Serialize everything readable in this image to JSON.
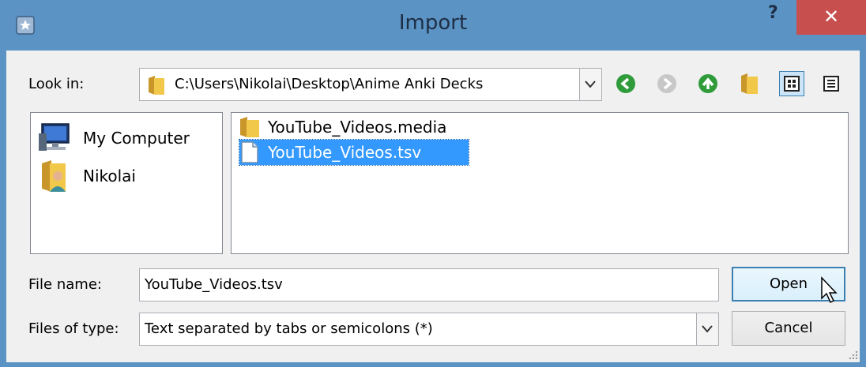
{
  "window": {
    "title": "Import",
    "help_label": "?",
    "close_label": "✕"
  },
  "toolbar": {
    "look_in_label": "Look in:",
    "path": "C:\\Users\\Nikolai\\Desktop\\Anime Anki Decks",
    "buttons": [
      "back-icon",
      "forward-icon",
      "up-icon",
      "new-folder-icon",
      "list-view-icon",
      "detail-view-icon"
    ]
  },
  "sidebar": {
    "items": [
      {
        "label": "My Computer",
        "icon": "computer-icon"
      },
      {
        "label": "Nikolai",
        "icon": "user-folder-icon"
      }
    ]
  },
  "files": {
    "items": [
      {
        "name": "YouTube_Videos.media",
        "icon": "folder-icon",
        "selected": false
      },
      {
        "name": "YouTube_Videos.tsv",
        "icon": "file-icon",
        "selected": true
      }
    ]
  },
  "filename": {
    "label": "File name:",
    "value": "YouTube_Videos.tsv"
  },
  "filetype": {
    "label": "Files of type:",
    "value": "Text separated by tabs or semicolons (*)"
  },
  "buttons": {
    "open": "Open",
    "cancel": "Cancel"
  },
  "colors": {
    "titlebar": "#5b93c4",
    "close": "#c7504f",
    "selection": "#3399ff",
    "nav_green": "#2f9b3a"
  }
}
